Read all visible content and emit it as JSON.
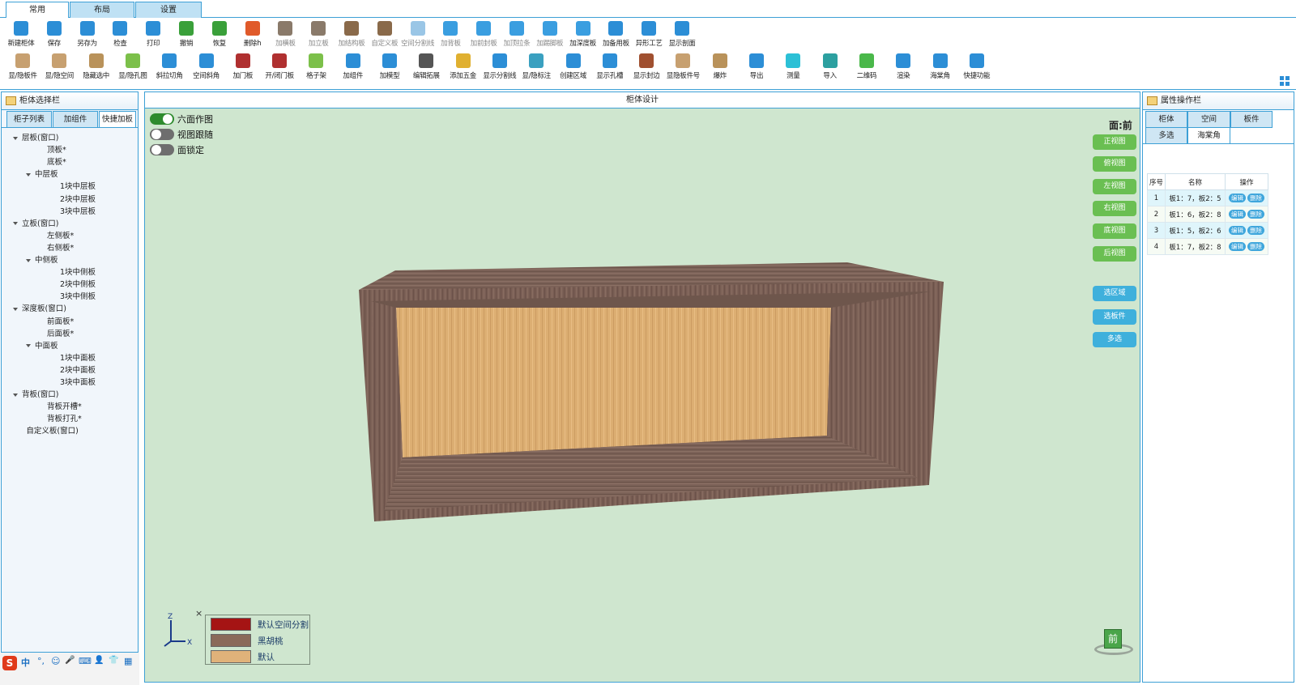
{
  "tabs": [
    {
      "label": "常用",
      "active": true
    },
    {
      "label": "布局",
      "active": false
    },
    {
      "label": "设置",
      "active": false
    }
  ],
  "toolbar_row1": [
    {
      "label": "新建柜体",
      "icon": "new-cabinet-icon",
      "color": "#2c8ed6"
    },
    {
      "label": "保存",
      "icon": "save-icon",
      "color": "#2c8ed6"
    },
    {
      "label": "另存为",
      "icon": "save-as-icon",
      "color": "#2c8ed6"
    },
    {
      "label": "检查",
      "icon": "check-icon",
      "color": "#2c8ed6"
    },
    {
      "label": "打印",
      "icon": "print-icon",
      "color": "#2c8ed6"
    },
    {
      "label": "撤销",
      "icon": "undo-icon",
      "color": "#3aa03a"
    },
    {
      "label": "恢复",
      "icon": "redo-icon",
      "color": "#3aa03a"
    },
    {
      "label": "删除h",
      "icon": "delete-icon",
      "color": "#e05a2a"
    },
    {
      "label": "加横板",
      "icon": "add-horizontal-board-icon",
      "color": "#8a7a6a",
      "dim": true
    },
    {
      "label": "加立板",
      "icon": "add-vertical-board-icon",
      "color": "#8a7a6a",
      "dim": true
    },
    {
      "label": "加结构板",
      "icon": "add-structure-board-icon",
      "color": "#8a6a4a",
      "dim": true
    },
    {
      "label": "自定义板",
      "icon": "custom-board-icon",
      "color": "#8a6a4a",
      "dim": true
    },
    {
      "label": "空间分割线",
      "icon": "space-split-icon",
      "color": "#9ac6e6",
      "dim": true
    },
    {
      "label": "加背板",
      "icon": "add-back-board-icon",
      "color": "#3a9ee0",
      "dim": true
    },
    {
      "label": "加前封板",
      "icon": "add-front-seal-icon",
      "color": "#3a9ee0",
      "dim": true
    },
    {
      "label": "加顶拉条",
      "icon": "add-top-strip-icon",
      "color": "#3a9ee0",
      "dim": true
    },
    {
      "label": "加踢脚板",
      "icon": "add-kick-board-icon",
      "color": "#3a9ee0",
      "dim": true
    },
    {
      "label": "加深度板",
      "icon": "add-depth-board-icon",
      "color": "#3a9ee0"
    },
    {
      "label": "加备用板",
      "icon": "add-spare-board-icon",
      "color": "#2c8ed6"
    },
    {
      "label": "异形工艺",
      "icon": "shaped-craft-icon",
      "color": "#2c8ed6"
    },
    {
      "label": "显示剖面",
      "icon": "show-section-icon",
      "color": "#2c8ed6"
    }
  ],
  "toolbar_row2": [
    {
      "label": "显/隐板件",
      "icon": "toggle-board-icon",
      "color": "#c7a070"
    },
    {
      "label": "显/隐空间",
      "icon": "toggle-space-icon",
      "color": "#c7a070"
    },
    {
      "label": "隐藏选中",
      "icon": "hide-selected-icon",
      "color": "#b9925a"
    },
    {
      "label": "显/隐孔图",
      "icon": "toggle-hole-icon",
      "color": "#7cc04a"
    },
    {
      "label": "斜拉切角",
      "icon": "bevel-cut-icon",
      "color": "#2c8ed6"
    },
    {
      "label": "空间斜角",
      "icon": "space-bevel-icon",
      "color": "#2c8ed6"
    },
    {
      "label": "加门板",
      "icon": "add-door-icon",
      "color": "#b03030"
    },
    {
      "label": "开/闭门板",
      "icon": "open-close-door-icon",
      "color": "#b03030"
    },
    {
      "label": "格子架",
      "icon": "grid-rack-icon",
      "color": "#7cc04a"
    },
    {
      "label": "加组件",
      "icon": "add-component-icon",
      "color": "#2c8ed6"
    },
    {
      "label": "加模型",
      "icon": "add-model-icon",
      "color": "#2c8ed6"
    },
    {
      "label": "编辑拓展",
      "icon": "edit-extension-icon",
      "color": "#555555"
    },
    {
      "label": "添加五金",
      "icon": "add-hardware-icon",
      "color": "#e0b030"
    },
    {
      "label": "显示分割线",
      "icon": "show-split-icon",
      "color": "#2c8ed6"
    },
    {
      "label": "显/隐标注",
      "icon": "toggle-annotation-icon",
      "color": "#3aa0c0"
    },
    {
      "label": "创建区域",
      "icon": "create-region-icon",
      "color": "#2c8ed6"
    },
    {
      "label": "显示孔槽",
      "icon": "show-hole-slot-icon",
      "color": "#2c8ed6"
    },
    {
      "label": "显示封边",
      "icon": "show-edge-band-icon",
      "color": "#a05030"
    },
    {
      "label": "显隐板件号",
      "icon": "toggle-board-number-icon",
      "color": "#c7a070"
    },
    {
      "label": "爆炸",
      "icon": "explode-icon",
      "color": "#b9925a"
    },
    {
      "label": "导出",
      "icon": "export-icon",
      "color": "#2c8ed6"
    },
    {
      "label": "测量",
      "icon": "measure-icon",
      "color": "#2cc0d6"
    },
    {
      "label": "导入",
      "icon": "import-icon",
      "color": "#2ca0a0"
    },
    {
      "label": "二维码",
      "icon": "qr-code-icon",
      "color": "#4ab84a"
    },
    {
      "label": "渲染",
      "icon": "render-icon",
      "color": "#2c8ed6"
    },
    {
      "label": "海棠角",
      "icon": "begonia-corner-icon",
      "color": "#2c8ed6"
    },
    {
      "label": "快捷功能",
      "icon": "quick-function-icon",
      "color": "#2c8ed6"
    }
  ],
  "left_panel": {
    "title": "柜体选择栏",
    "tabs": [
      {
        "label": "柜子列表",
        "active": false
      },
      {
        "label": "加组件",
        "active": false
      },
      {
        "label": "快捷加板",
        "active": true
      }
    ],
    "tree": [
      {
        "label": "层板(窗口)",
        "level": 0,
        "arrow": true
      },
      {
        "label": "顶板*",
        "level": 2,
        "arrow": false
      },
      {
        "label": "底板*",
        "level": 2,
        "arrow": false
      },
      {
        "label": "中层板",
        "level": 1,
        "arrow": true
      },
      {
        "label": "1块中层板",
        "level": 3,
        "arrow": false
      },
      {
        "label": "2块中层板",
        "level": 3,
        "arrow": false
      },
      {
        "label": "3块中层板",
        "level": 3,
        "arrow": false
      },
      {
        "label": "立板(窗口)",
        "level": 0,
        "arrow": true
      },
      {
        "label": "左侧板*",
        "level": 2,
        "arrow": false
      },
      {
        "label": "右侧板*",
        "level": 2,
        "arrow": false
      },
      {
        "label": "中侧板",
        "level": 1,
        "arrow": true
      },
      {
        "label": "1块中侧板",
        "level": 3,
        "arrow": false
      },
      {
        "label": "2块中侧板",
        "level": 3,
        "arrow": false
      },
      {
        "label": "3块中侧板",
        "level": 3,
        "arrow": false
      },
      {
        "label": "深度板(窗口)",
        "level": 0,
        "arrow": true
      },
      {
        "label": "前面板*",
        "level": 2,
        "arrow": false
      },
      {
        "label": "后面板*",
        "level": 2,
        "arrow": false
      },
      {
        "label": "中面板",
        "level": 1,
        "arrow": true
      },
      {
        "label": "1块中面板",
        "level": 3,
        "arrow": false
      },
      {
        "label": "2块中面板",
        "level": 3,
        "arrow": false
      },
      {
        "label": "3块中面板",
        "level": 3,
        "arrow": false
      },
      {
        "label": "背板(窗口)",
        "level": 0,
        "arrow": true
      },
      {
        "label": "背板开槽*",
        "level": 2,
        "arrow": false
      },
      {
        "label": "背板打孔*",
        "level": 2,
        "arrow": false
      },
      {
        "label": "自定义板(窗口)",
        "level": 0.4,
        "arrow": false
      }
    ]
  },
  "canvas": {
    "title": "柜体设计",
    "face_label": "面:前",
    "toggles": [
      {
        "label": "六面作图",
        "on": true
      },
      {
        "label": "视图跟随",
        "on": false
      },
      {
        "label": "面锁定",
        "on": false
      }
    ],
    "view_buttons": [
      "正视图",
      "俯视图",
      "左视图",
      "右视图",
      "底视图",
      "后视图"
    ],
    "action_buttons": [
      "选区域",
      "选板件",
      "多选"
    ],
    "axis": {
      "z": "Z",
      "x": "X"
    },
    "legend_close": "×",
    "legend": [
      {
        "label": "默认空间分割",
        "color": "#a51414"
      },
      {
        "label": "黑胡桃",
        "color": "#8a6a5a"
      },
      {
        "label": "默认",
        "color": "#e0b27a"
      }
    ],
    "nav_cube_label": "前"
  },
  "right_panel": {
    "title": "属性操作栏",
    "tabs_row1": [
      {
        "label": "柜体",
        "active": false
      },
      {
        "label": "空间",
        "active": false
      },
      {
        "label": "板件",
        "active": false
      }
    ],
    "tabs_row2": [
      {
        "label": "多选",
        "active": false
      },
      {
        "label": "海棠角",
        "active": true
      }
    ],
    "table": {
      "headers": [
        "序号",
        "名称",
        "操作"
      ],
      "rows": [
        {
          "no": "1",
          "name": "板1：7，板2：5"
        },
        {
          "no": "2",
          "name": "板1：6，板2：8"
        },
        {
          "no": "3",
          "name": "板1：5，板2：6"
        },
        {
          "no": "4",
          "name": "板1：7，板2：8"
        }
      ],
      "edit_label": "编辑",
      "delete_label": "删除"
    }
  },
  "ime_bar": {
    "logo": "S",
    "mode": "中",
    "punct": "°,",
    "emoji": "☺",
    "mic": "🎤",
    "keyboard": "⌨",
    "user": "👤",
    "skin": "👕",
    "grid": "▦"
  }
}
